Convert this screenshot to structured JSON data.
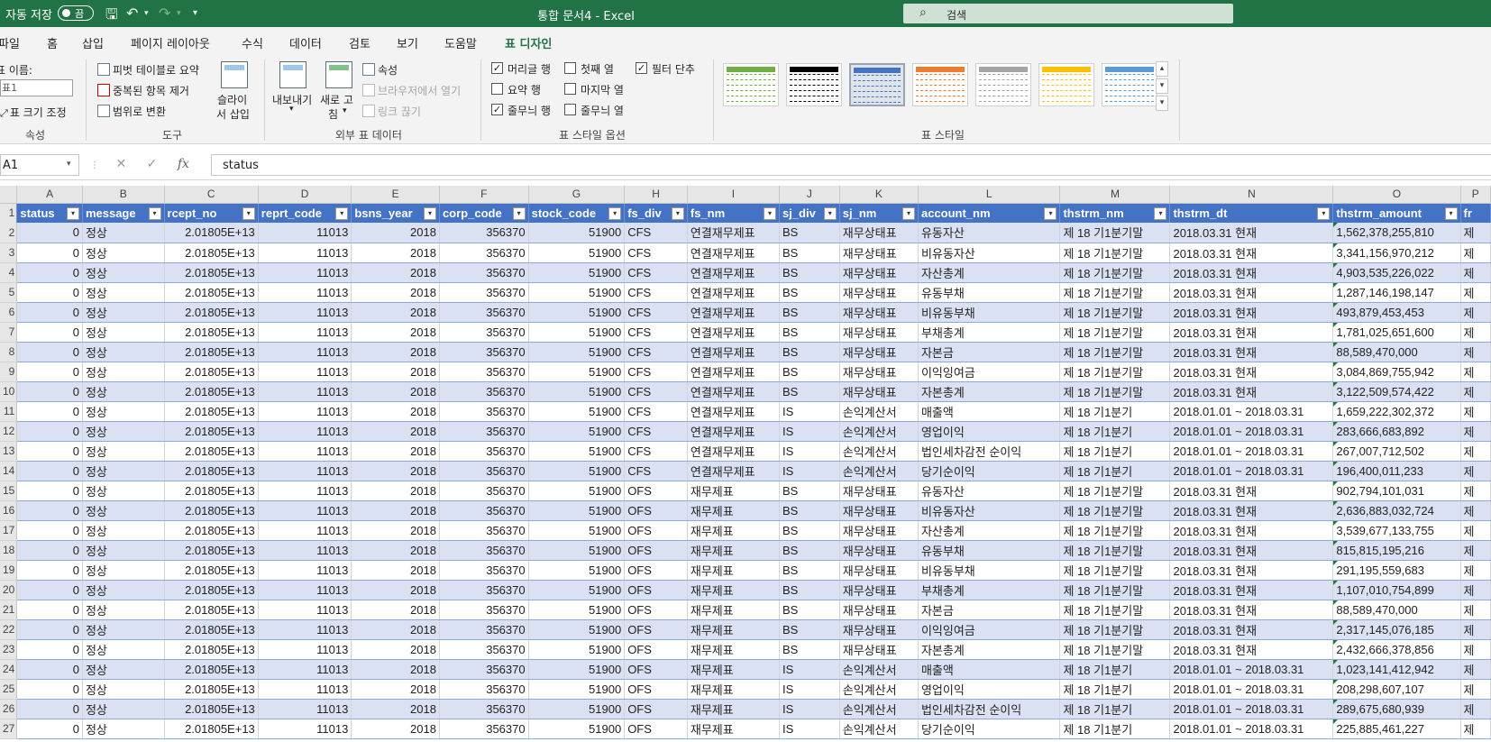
{
  "titlebar": {
    "autosave_label": "자동 저장",
    "autosave_state": "끔",
    "doc_title": "통합 문서4 - Excel",
    "search_placeholder": "검색"
  },
  "ribbon_tabs": [
    "파일",
    "홈",
    "삽입",
    "페이지 레이아웃",
    "수식",
    "데이터",
    "검토",
    "보기",
    "도움말",
    "표 디자인"
  ],
  "ribbon": {
    "properties": {
      "table_name_label": "표 이름:",
      "table_name_value": "표1",
      "resize_label": "표 크기 조정",
      "group_label": "속성"
    },
    "tools": {
      "pivot_label": "피벗 테이블로 요약",
      "remove_dup_label": "중복된 항목 제거",
      "convert_range_label": "범위로 변환",
      "slicer_label_1": "슬라이",
      "slicer_label_2": "서 삽입",
      "group_label": "도구"
    },
    "external": {
      "export_label": "내보내기",
      "refresh_label_1": "새로 고",
      "refresh_label_2": "침",
      "properties_label": "속성",
      "open_browser_label": "브라우저에서 열기",
      "unlink_label": "링크 끊기",
      "group_label": "외부 표 데이터"
    },
    "style_options": {
      "header_row": "머리글 행",
      "total_row": "요약 행",
      "banded_rows": "줄무늬 행",
      "first_column": "첫째 열",
      "last_column": "마지막 열",
      "banded_columns": "줄무늬 열",
      "filter_button": "필터 단추",
      "group_label": "표 스타일 옵션",
      "checked": {
        "header_row": true,
        "total_row": false,
        "banded_rows": true,
        "first_column": false,
        "last_column": false,
        "banded_columns": false,
        "filter_button": true
      }
    },
    "styles": {
      "group_label": "표 스타일",
      "thumbs": [
        {
          "color": "#70ad47",
          "header": "#ffffff",
          "selected": false
        },
        {
          "color": "#000000",
          "header": "#000000",
          "selected": false
        },
        {
          "color": "#4472c4",
          "header": "#ffffff",
          "selected": true
        },
        {
          "color": "#ed7d31",
          "header": "#ed7d31",
          "selected": false
        },
        {
          "color": "#a5a5a5",
          "header": "#a5a5a5",
          "selected": false
        },
        {
          "color": "#ffc000",
          "header": "#ffc000",
          "selected": false
        },
        {
          "color": "#5b9bd5",
          "header": "#5b9bd5",
          "selected": false
        }
      ]
    }
  },
  "formula_bar": {
    "name_box": "A1",
    "formula": "status"
  },
  "sheet": {
    "col_letters": [
      "A",
      "B",
      "C",
      "D",
      "E",
      "F",
      "G",
      "H",
      "I",
      "J",
      "K",
      "L",
      "M",
      "N",
      "O",
      "P"
    ],
    "headers": [
      "status",
      "message",
      "rcept_no",
      "reprt_code",
      "bsns_year",
      "corp_code",
      "stock_code",
      "fs_div",
      "fs_nm",
      "sj_div",
      "sj_nm",
      "account_nm",
      "thstrm_nm",
      "thstrm_dt",
      "thstrm_amount",
      "fr"
    ],
    "row_numbers": [
      "1",
      "2",
      "3",
      "4",
      "5",
      "6",
      "7",
      "8",
      "9",
      "10",
      "11",
      "12",
      "13",
      "14",
      "15",
      "16",
      "17",
      "18",
      "19",
      "20",
      "21",
      "22",
      "23",
      "24",
      "25",
      "26",
      "27"
    ],
    "rows": [
      [
        "0",
        "정상",
        "2.01805E+13",
        "11013",
        "2018",
        "356370",
        "51900",
        "CFS",
        "연결재무제표",
        "BS",
        "재무상태표",
        "유동자산",
        "제 18 기1분기말",
        "2018.03.31 현재",
        "1,562,378,255,810",
        "제"
      ],
      [
        "0",
        "정상",
        "2.01805E+13",
        "11013",
        "2018",
        "356370",
        "51900",
        "CFS",
        "연결재무제표",
        "BS",
        "재무상태표",
        "비유동자산",
        "제 18 기1분기말",
        "2018.03.31 현재",
        "3,341,156,970,212",
        "제"
      ],
      [
        "0",
        "정상",
        "2.01805E+13",
        "11013",
        "2018",
        "356370",
        "51900",
        "CFS",
        "연결재무제표",
        "BS",
        "재무상태표",
        "자산총계",
        "제 18 기1분기말",
        "2018.03.31 현재",
        "4,903,535,226,022",
        "제"
      ],
      [
        "0",
        "정상",
        "2.01805E+13",
        "11013",
        "2018",
        "356370",
        "51900",
        "CFS",
        "연결재무제표",
        "BS",
        "재무상태표",
        "유동부채",
        "제 18 기1분기말",
        "2018.03.31 현재",
        "1,287,146,198,147",
        "제"
      ],
      [
        "0",
        "정상",
        "2.01805E+13",
        "11013",
        "2018",
        "356370",
        "51900",
        "CFS",
        "연결재무제표",
        "BS",
        "재무상태표",
        "비유동부채",
        "제 18 기1분기말",
        "2018.03.31 현재",
        "493,879,453,453",
        "제"
      ],
      [
        "0",
        "정상",
        "2.01805E+13",
        "11013",
        "2018",
        "356370",
        "51900",
        "CFS",
        "연결재무제표",
        "BS",
        "재무상태표",
        "부채총계",
        "제 18 기1분기말",
        "2018.03.31 현재",
        "1,781,025,651,600",
        "제"
      ],
      [
        "0",
        "정상",
        "2.01805E+13",
        "11013",
        "2018",
        "356370",
        "51900",
        "CFS",
        "연결재무제표",
        "BS",
        "재무상태표",
        "자본금",
        "제 18 기1분기말",
        "2018.03.31 현재",
        "88,589,470,000",
        "제"
      ],
      [
        "0",
        "정상",
        "2.01805E+13",
        "11013",
        "2018",
        "356370",
        "51900",
        "CFS",
        "연결재무제표",
        "BS",
        "재무상태표",
        "이익잉여금",
        "제 18 기1분기말",
        "2018.03.31 현재",
        "3,084,869,755,942",
        "제"
      ],
      [
        "0",
        "정상",
        "2.01805E+13",
        "11013",
        "2018",
        "356370",
        "51900",
        "CFS",
        "연결재무제표",
        "BS",
        "재무상태표",
        "자본총계",
        "제 18 기1분기말",
        "2018.03.31 현재",
        "3,122,509,574,422",
        "제"
      ],
      [
        "0",
        "정상",
        "2.01805E+13",
        "11013",
        "2018",
        "356370",
        "51900",
        "CFS",
        "연결재무제표",
        "IS",
        "손익계산서",
        "매출액",
        "제 18 기1분기",
        "2018.01.01 ~ 2018.03.31",
        "1,659,222,302,372",
        "제"
      ],
      [
        "0",
        "정상",
        "2.01805E+13",
        "11013",
        "2018",
        "356370",
        "51900",
        "CFS",
        "연결재무제표",
        "IS",
        "손익계산서",
        "영업이익",
        "제 18 기1분기",
        "2018.01.01 ~ 2018.03.31",
        "283,666,683,892",
        "제"
      ],
      [
        "0",
        "정상",
        "2.01805E+13",
        "11013",
        "2018",
        "356370",
        "51900",
        "CFS",
        "연결재무제표",
        "IS",
        "손익계산서",
        "법인세차감전 순이익",
        "제 18 기1분기",
        "2018.01.01 ~ 2018.03.31",
        "267,007,712,502",
        "제"
      ],
      [
        "0",
        "정상",
        "2.01805E+13",
        "11013",
        "2018",
        "356370",
        "51900",
        "CFS",
        "연결재무제표",
        "IS",
        "손익계산서",
        "당기순이익",
        "제 18 기1분기",
        "2018.01.01 ~ 2018.03.31",
        "196,400,011,233",
        "제"
      ],
      [
        "0",
        "정상",
        "2.01805E+13",
        "11013",
        "2018",
        "356370",
        "51900",
        "OFS",
        "재무제표",
        "BS",
        "재무상태표",
        "유동자산",
        "제 18 기1분기말",
        "2018.03.31 현재",
        "902,794,101,031",
        "제"
      ],
      [
        "0",
        "정상",
        "2.01805E+13",
        "11013",
        "2018",
        "356370",
        "51900",
        "OFS",
        "재무제표",
        "BS",
        "재무상태표",
        "비유동자산",
        "제 18 기1분기말",
        "2018.03.31 현재",
        "2,636,883,032,724",
        "제"
      ],
      [
        "0",
        "정상",
        "2.01805E+13",
        "11013",
        "2018",
        "356370",
        "51900",
        "OFS",
        "재무제표",
        "BS",
        "재무상태표",
        "자산총계",
        "제 18 기1분기말",
        "2018.03.31 현재",
        "3,539,677,133,755",
        "제"
      ],
      [
        "0",
        "정상",
        "2.01805E+13",
        "11013",
        "2018",
        "356370",
        "51900",
        "OFS",
        "재무제표",
        "BS",
        "재무상태표",
        "유동부채",
        "제 18 기1분기말",
        "2018.03.31 현재",
        "815,815,195,216",
        "제"
      ],
      [
        "0",
        "정상",
        "2.01805E+13",
        "11013",
        "2018",
        "356370",
        "51900",
        "OFS",
        "재무제표",
        "BS",
        "재무상태표",
        "비유동부채",
        "제 18 기1분기말",
        "2018.03.31 현재",
        "291,195,559,683",
        "제"
      ],
      [
        "0",
        "정상",
        "2.01805E+13",
        "11013",
        "2018",
        "356370",
        "51900",
        "OFS",
        "재무제표",
        "BS",
        "재무상태표",
        "부채총계",
        "제 18 기1분기말",
        "2018.03.31 현재",
        "1,107,010,754,899",
        "제"
      ],
      [
        "0",
        "정상",
        "2.01805E+13",
        "11013",
        "2018",
        "356370",
        "51900",
        "OFS",
        "재무제표",
        "BS",
        "재무상태표",
        "자본금",
        "제 18 기1분기말",
        "2018.03.31 현재",
        "88,589,470,000",
        "제"
      ],
      [
        "0",
        "정상",
        "2.01805E+13",
        "11013",
        "2018",
        "356370",
        "51900",
        "OFS",
        "재무제표",
        "BS",
        "재무상태표",
        "이익잉여금",
        "제 18 기1분기말",
        "2018.03.31 현재",
        "2,317,145,076,185",
        "제"
      ],
      [
        "0",
        "정상",
        "2.01805E+13",
        "11013",
        "2018",
        "356370",
        "51900",
        "OFS",
        "재무제표",
        "BS",
        "재무상태표",
        "자본총계",
        "제 18 기1분기말",
        "2018.03.31 현재",
        "2,432,666,378,856",
        "제"
      ],
      [
        "0",
        "정상",
        "2.01805E+13",
        "11013",
        "2018",
        "356370",
        "51900",
        "OFS",
        "재무제표",
        "IS",
        "손익계산서",
        "매출액",
        "제 18 기1분기",
        "2018.01.01 ~ 2018.03.31",
        "1,023,141,412,942",
        "제"
      ],
      [
        "0",
        "정상",
        "2.01805E+13",
        "11013",
        "2018",
        "356370",
        "51900",
        "OFS",
        "재무제표",
        "IS",
        "손익계산서",
        "영업이익",
        "제 18 기1분기",
        "2018.01.01 ~ 2018.03.31",
        "208,298,607,107",
        "제"
      ],
      [
        "0",
        "정상",
        "2.01805E+13",
        "11013",
        "2018",
        "356370",
        "51900",
        "OFS",
        "재무제표",
        "IS",
        "손익계산서",
        "법인세차감전 순이익",
        "제 18 기1분기",
        "2018.01.01 ~ 2018.03.31",
        "289,675,680,939",
        "제"
      ],
      [
        "0",
        "정상",
        "2.01805E+13",
        "11013",
        "2018",
        "356370",
        "51900",
        "OFS",
        "재무제표",
        "IS",
        "손익계산서",
        "당기순이익",
        "제 18 기1분기",
        "2018.01.01 ~ 2018.03.31",
        "225,885,461,227",
        "제"
      ]
    ]
  }
}
